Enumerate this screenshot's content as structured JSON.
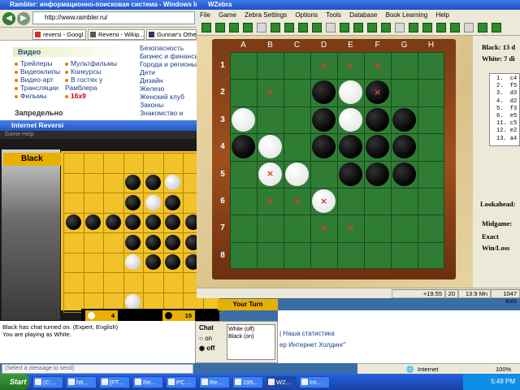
{
  "ie": {
    "title": "Rambler: информационно-поисковая система - Windows Internet Explorer",
    "address": "http://www.rambler.ru/",
    "tabs": [
      "reversi - Googl...",
      "Reversi - Wikip...",
      "Gunnar's Othel"
    ],
    "video_title": "Видео",
    "video_links_col1": [
      "Трейлеры",
      "Видеоклипы",
      "Видео-арт",
      "Трансляции",
      "Фильмы"
    ],
    "video_links_col2": [
      "Мультфильмы",
      "Конкурсы",
      "В гостях у Рамблера",
      "16x9"
    ],
    "right_links": [
      "Безопасность",
      "Бизнес и финансы",
      "Города и регионы",
      "Дети",
      "Дизайн",
      "Железо",
      "Женский клуб",
      "Законы",
      "Знакомство и"
    ],
    "prohibited": "Запредельно",
    "bottom_text_1": "| Наша статистика",
    "bottom_text_2": "ер Интернет Холдинг\"",
    "status_zone": "Internet",
    "status_zoom": "100%"
  },
  "reversi": {
    "title": "Internet Reversi",
    "menu": "Game   Help",
    "player_label": "Black",
    "white_score": "4",
    "black_score": "15",
    "turn_label": "Your Turn",
    "chat_lines": [
      "Black has chat turned on.  (Expert, English)",
      "You are playing as White."
    ],
    "chat_placeholder": "(Select a message to send)",
    "chat_label": "Chat",
    "chat_on": "on",
    "chat_off": "off",
    "chat_white": "White (off)",
    "chat_black": "Black (on)",
    "board": [
      "........",
      "...BBW..",
      "...BWB..",
      "BBBBBBBB",
      "...BBBB.",
      "...WBBB.",
      "........",
      "...W...."
    ],
    "colors": {
      "board": "#f2c22a",
      "accent": "#e8b000"
    }
  },
  "wzebra": {
    "title": "WZebra",
    "menu": [
      "File",
      "Game",
      "Zebra Settings",
      "Options",
      "Tools",
      "Database",
      "Book Learning",
      "Help"
    ],
    "col_labels": [
      "A",
      "B",
      "C",
      "D",
      "E",
      "F",
      "G",
      "H"
    ],
    "row_labels": [
      "1",
      "2",
      "3",
      "4",
      "5",
      "6",
      "7",
      "8"
    ],
    "board": [
      "........",
      "...BWB..",
      "W..BWBB.",
      "BW.BBBB.",
      ".WW.BBB.",
      "...W....",
      "........",
      "........"
    ],
    "hints": [
      [
        3,
        0
      ],
      [
        4,
        0
      ],
      [
        5,
        0
      ],
      [
        1,
        1
      ],
      [
        5,
        1
      ],
      [
        1,
        4
      ],
      [
        1,
        5
      ],
      [
        2,
        5
      ],
      [
        3,
        5
      ],
      [
        3,
        6
      ],
      [
        4,
        6
      ]
    ],
    "black_label": "Black:",
    "black_count": "13 d",
    "white_label": "White:",
    "white_count": "7 di",
    "moves": [
      "1.  c4",
      "2.  f5",
      "3.  d3",
      "4.  d2",
      "5.  f3",
      "6.  e5",
      "11. c5",
      "12. e2",
      "13. a4"
    ],
    "lookahead": "Lookahead:",
    "midgame": "Midgame:",
    "exact": "Exact",
    "winloss": "Win/Loss",
    "status": [
      "+19.55",
      "20",
      "13.9 Mn",
      "1047 kn/s"
    ],
    "colors": {
      "board": "#2f7d35",
      "hint": "#e03c3c",
      "frame": "#8b4418"
    }
  },
  "taskbar": {
    "start": "Start",
    "buttons": [
      "(C:...",
      "htt...",
      "[FT...",
      "Re...",
      "PC ...",
      "Re...",
      "195...",
      "WZ...",
      "Int..."
    ],
    "clock": "5:49 PM"
  }
}
